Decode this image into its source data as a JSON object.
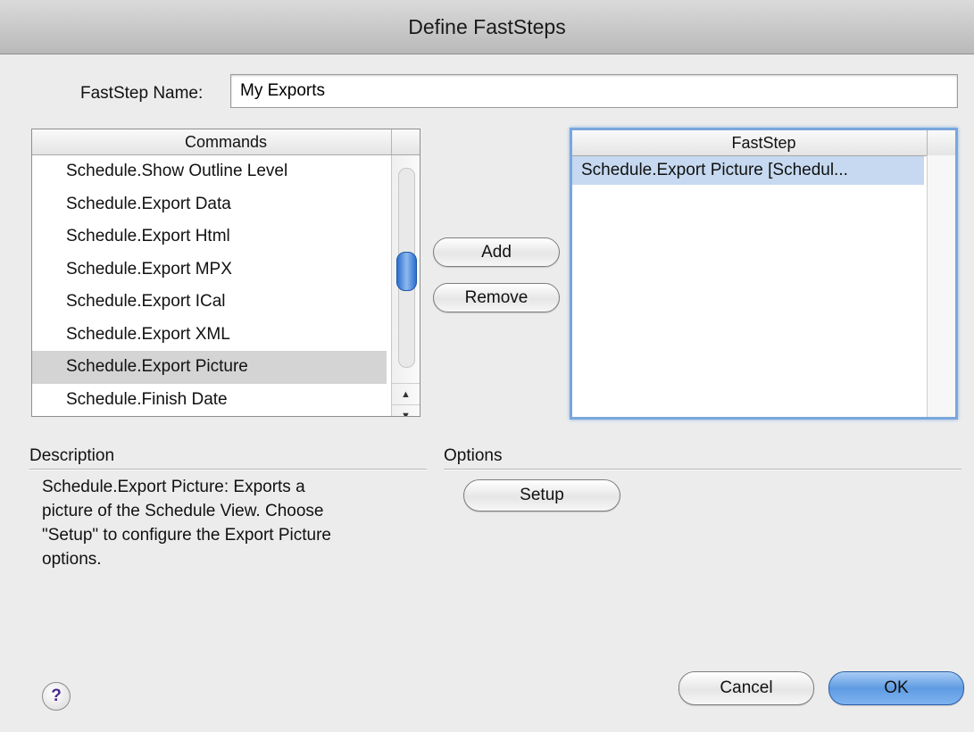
{
  "window": {
    "title": "Define FastSteps"
  },
  "name_field": {
    "label": "FastStep Name:",
    "value": "My Exports"
  },
  "commands": {
    "header": "Commands",
    "items": [
      "Schedule.Show Outline Level",
      "Schedule.Export Data",
      "Schedule.Export Html",
      "Schedule.Export MPX",
      "Schedule.Export ICal",
      "Schedule.Export XML",
      "Schedule.Export Picture",
      "Schedule.Finish Date"
    ],
    "selected_index": 6,
    "scroll_up_glyph": "▲",
    "scroll_down_glyph": "▼"
  },
  "faststep": {
    "header": "FastStep",
    "items": [
      "Schedule.Export Picture [Schedul..."
    ]
  },
  "buttons": {
    "add": "Add",
    "remove": "Remove",
    "setup": "Setup",
    "cancel": "Cancel",
    "ok": "OK"
  },
  "description": {
    "label": "Description",
    "text_lines": [
      "Schedule.Export Picture: Exports a",
      "picture of the Schedule View.  Choose",
      "\"Setup\" to configure the Export Picture",
      "options."
    ]
  },
  "options": {
    "label": "Options"
  },
  "help": {
    "glyph": "?",
    "icon": "help-icon"
  },
  "colors": {
    "selection_blue": "#c6d9f0",
    "default_button_blue": "#5f9be3",
    "focus_ring": "#7aa6dc"
  }
}
